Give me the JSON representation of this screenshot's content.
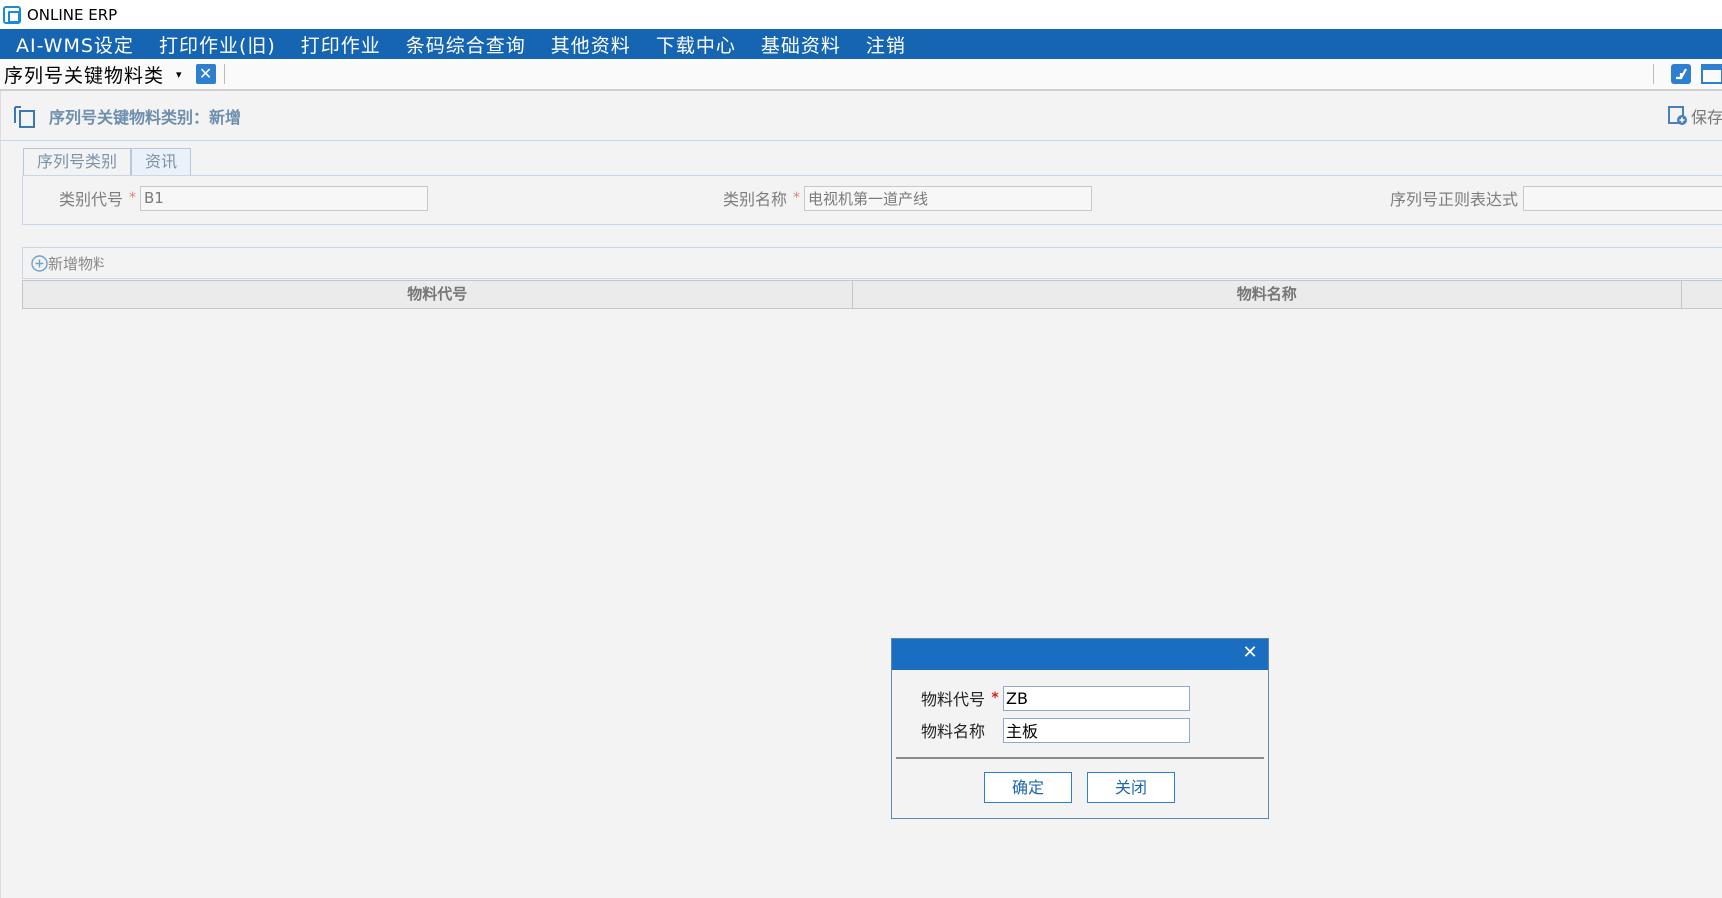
{
  "window": {
    "title": "ONLINE ERP"
  },
  "menu": {
    "items": [
      "AI-WMS设定",
      "打印作业(旧)",
      "打印作业",
      "条码综合查询",
      "其他资料",
      "下载中心",
      "基础资料",
      "注销"
    ]
  },
  "tab": {
    "label": "序列号关键物料类",
    "dropdown": "▾",
    "close": "✕"
  },
  "form": {
    "title": "序列号关键物料类别：新增",
    "save_label": "保存",
    "subtabs": [
      "序列号类别",
      "资讯"
    ],
    "fields": {
      "code_label": "类别代号",
      "code_value": "B1",
      "name_label": "类别名称",
      "name_value": "电视机第一道产线",
      "regex_label": "序列号正则表达式",
      "regex_value": "",
      "required_mark": "*"
    },
    "grid": {
      "add_label": "新增物料",
      "columns": [
        "物料代号",
        "物料名称"
      ]
    }
  },
  "dialog": {
    "close": "✕",
    "code_label": "物料代号",
    "code_value": "ZB",
    "name_label": "物料名称",
    "name_value": "主板",
    "required_mark": "*",
    "confirm_label": "确定",
    "close_label": "关闭"
  },
  "colors": {
    "menubar": "#1565b3",
    "dialog_title": "#1a6ec2",
    "button_text": "#1c65b0"
  }
}
